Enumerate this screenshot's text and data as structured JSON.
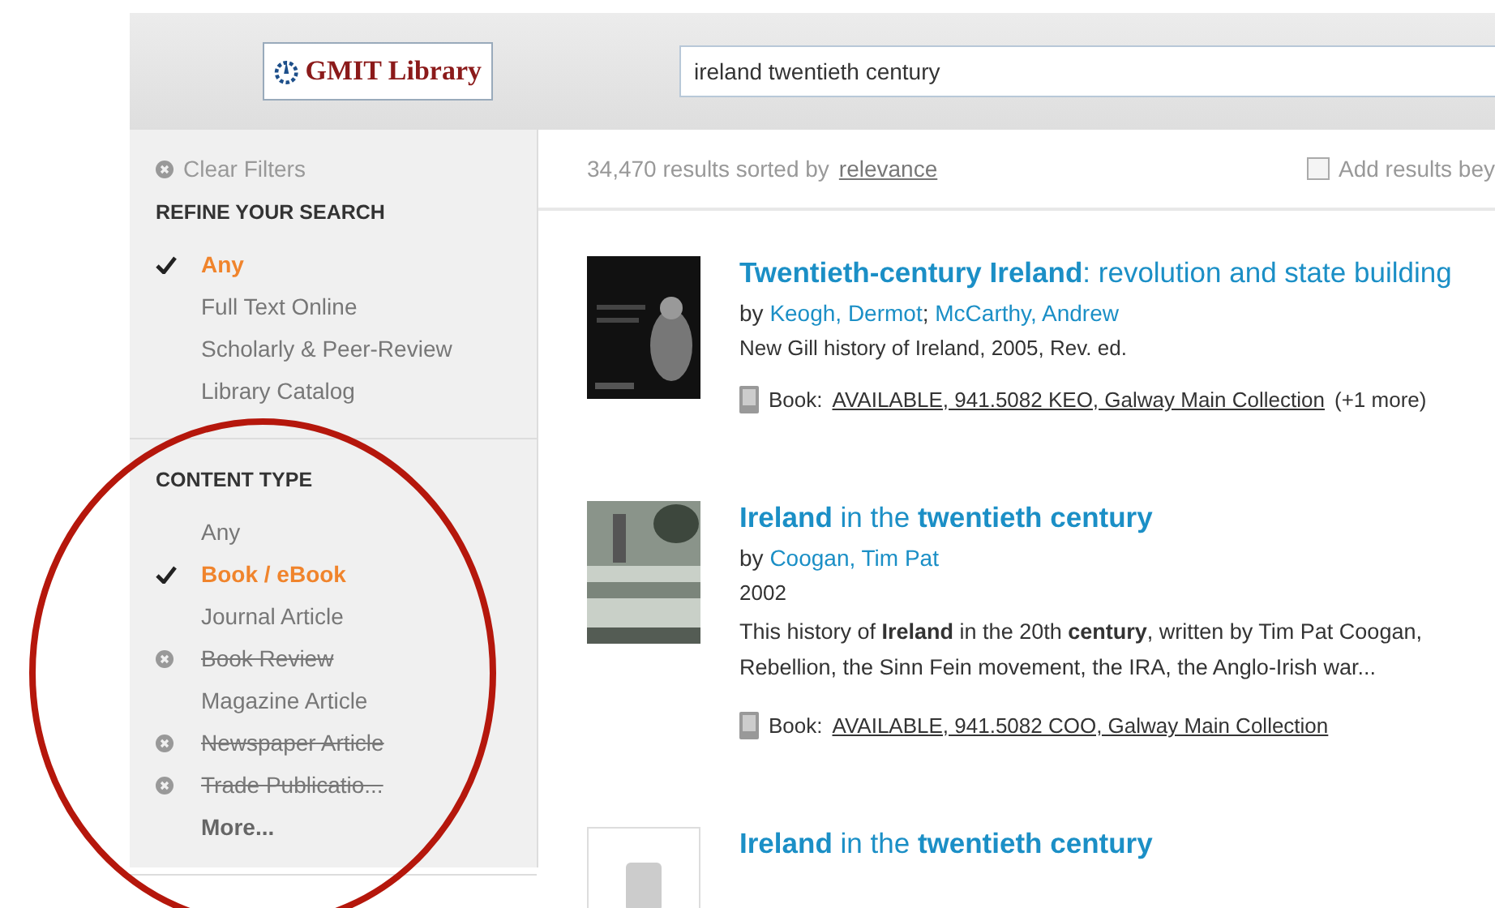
{
  "header": {
    "logo_text": "GMIT Library",
    "search": {
      "value": "ireland twentieth century"
    }
  },
  "sidebar": {
    "clear_filters": "Clear Filters",
    "sections": [
      {
        "heading": "REFINE YOUR SEARCH",
        "items": [
          {
            "label": "Any",
            "selected": true,
            "excluded": false
          },
          {
            "label": "Full Text Online",
            "selected": false,
            "excluded": false
          },
          {
            "label": "Scholarly & Peer-Review",
            "selected": false,
            "excluded": false
          },
          {
            "label": "Library Catalog",
            "selected": false,
            "excluded": false
          }
        ]
      },
      {
        "heading": "CONTENT TYPE",
        "items": [
          {
            "label": "Any",
            "selected": false,
            "excluded": false
          },
          {
            "label": "Book / eBook",
            "selected": true,
            "excluded": false
          },
          {
            "label": "Journal Article",
            "selected": false,
            "excluded": false
          },
          {
            "label": "Book Review",
            "selected": false,
            "excluded": true
          },
          {
            "label": "Magazine Article",
            "selected": false,
            "excluded": false
          },
          {
            "label": "Newspaper Article",
            "selected": false,
            "excluded": true
          },
          {
            "label": "Trade Publicatio...",
            "selected": false,
            "excluded": true
          }
        ],
        "more": "More..."
      }
    ]
  },
  "results": {
    "summary": "34,470 results sorted by",
    "sort": "relevance",
    "add_results": {
      "label": "Add results bey",
      "checked": false
    },
    "items": [
      {
        "title": "**Twentieth-century Ireland**: revolution and state building",
        "by": "by",
        "author_separator": ";",
        "authors": [
          "Keogh, Dermot",
          "McCarthy, Andrew"
        ],
        "details": [
          "New Gill history of Ireland, 2005, Rev. ed."
        ],
        "holding": {
          "format": "Book:",
          "link": "AVAILABLE, 941.5082 KEO, Galway Main Collection",
          "extra": "(+1 more)"
        }
      },
      {
        "title": "**Ireland** in the **twentieth century**",
        "by": "by",
        "authors": [
          "Coogan, Tim Pat"
        ],
        "details": [
          "2002"
        ],
        "snippet": "This history of **Ireland** in the 20th **century**, written by Tim Pat Coogan, Rebellion, the Sinn Fein movement, the IRA, the Anglo-Irish war...",
        "holding": {
          "format": "Book:",
          "link": "AVAILABLE, 941.5082 COO, Galway Main Collection"
        }
      },
      {
        "title": "**Ireland** in the **twentieth century**"
      }
    ]
  }
}
